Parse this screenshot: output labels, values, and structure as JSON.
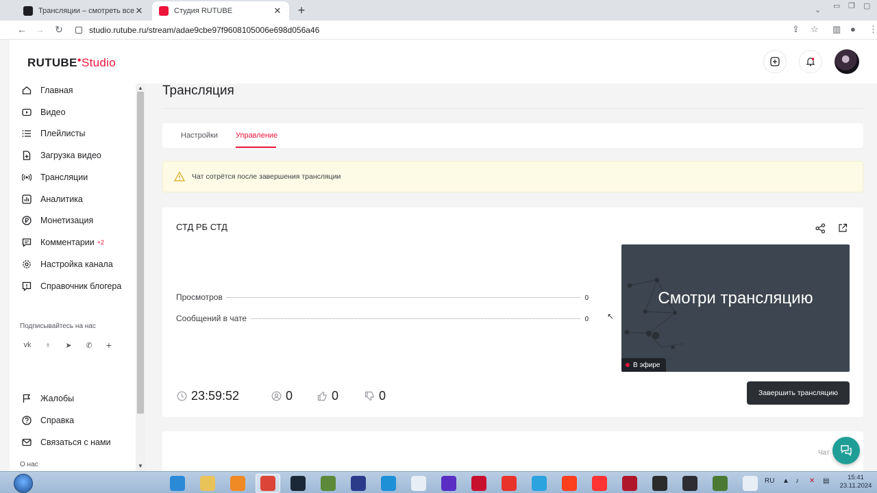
{
  "browser": {
    "tabs": [
      {
        "title": "Трансляции – смотреть все вид",
        "active": false,
        "favicon_color": "#1f1f23"
      },
      {
        "title": "Студия RUTUBE",
        "active": true,
        "favicon_color": "#ed143b"
      }
    ],
    "url": "studio.rutube.ru/stream/adae9cbe97f9608105006e698d056a46"
  },
  "header": {
    "logo_main": "RUTUBE",
    "logo_studio": "Studio"
  },
  "sidebar": {
    "items": [
      {
        "label": "Главная",
        "icon": "home-icon"
      },
      {
        "label": "Видео",
        "icon": "video-icon"
      },
      {
        "label": "Плейлисты",
        "icon": "playlist-icon"
      },
      {
        "label": "Загрузка видео",
        "icon": "upload-icon"
      },
      {
        "label": "Трансляции",
        "icon": "broadcast-icon"
      },
      {
        "label": "Аналитика",
        "icon": "analytics-icon"
      },
      {
        "label": "Монетизация",
        "icon": "ruble-icon"
      },
      {
        "label": "Комментарии",
        "icon": "comment-icon",
        "badge": "+2"
      },
      {
        "label": "Настройка канала",
        "icon": "gear-icon"
      },
      {
        "label": "Справочник блогера",
        "icon": "info-icon"
      }
    ],
    "subscribe_label": "Подписывайтесь на нас",
    "social": [
      "vk-icon",
      "ok-icon",
      "telegram-icon",
      "viber-icon",
      "plus-icon"
    ],
    "bottom_items": [
      {
        "label": "Жалобы",
        "icon": "flag-icon"
      },
      {
        "label": "Справка",
        "icon": "help-icon"
      },
      {
        "label": "Связаться с нами",
        "icon": "mail-icon"
      }
    ],
    "about_label": "О нас"
  },
  "main": {
    "title": "Трансляция",
    "tabs": [
      {
        "label": "Настройки",
        "active": false
      },
      {
        "label": "Управление",
        "active": true
      }
    ],
    "warning": "Чат сотрётся после завершения трансляции",
    "stream": {
      "name": "СТД РБ СТД",
      "stats": [
        {
          "label": "Просмотров",
          "value": "0"
        },
        {
          "label": "Сообщений в чате",
          "value": "0"
        }
      ],
      "preview_text": "Смотри трансляцию",
      "live_label": "В эфире",
      "duration": "23:59:52",
      "viewers": "0",
      "likes": "0",
      "dislikes": "0",
      "end_button": "Завершить трансляцию"
    },
    "chat_label": "Чат"
  },
  "taskbar": {
    "lang": "RU",
    "time": "15:41",
    "date": "23.11.2024",
    "apps": [
      {
        "name": "ie-icon",
        "color": "#2a8ad8"
      },
      {
        "name": "explorer-icon",
        "color": "#e8c35a"
      },
      {
        "name": "media-player-icon",
        "color": "#f08a24"
      },
      {
        "name": "chrome-icon",
        "color": "#db4437",
        "active": true
      },
      {
        "name": "steam-icon",
        "color": "#1b2838"
      },
      {
        "name": "minecraft-icon",
        "color": "#5c8a3a"
      },
      {
        "name": "app-icon",
        "color": "#2c3a8a"
      },
      {
        "name": "app-blue-icon",
        "color": "#1e90d6"
      },
      {
        "name": "app-white-icon",
        "color": "#e8eef5"
      },
      {
        "name": "app-purple-icon",
        "color": "#5a2ec4"
      },
      {
        "name": "recorder-icon",
        "color": "#c8102e"
      },
      {
        "name": "wps-icon",
        "color": "#e8332a"
      },
      {
        "name": "telegram-icon",
        "color": "#2aa3de"
      },
      {
        "name": "yandex-icon",
        "color": "#fc3f1d"
      },
      {
        "name": "yandex-browser-icon",
        "color": "#ff3333"
      },
      {
        "name": "game-icon",
        "color": "#b0162b"
      },
      {
        "name": "app-2-icon",
        "color": "#2b2b2b"
      },
      {
        "name": "obs-icon",
        "color": "#2d2d33"
      },
      {
        "name": "minecraft-2-icon",
        "color": "#4b7a34"
      },
      {
        "name": "pen-icon",
        "color": "#e8eef5"
      }
    ]
  }
}
